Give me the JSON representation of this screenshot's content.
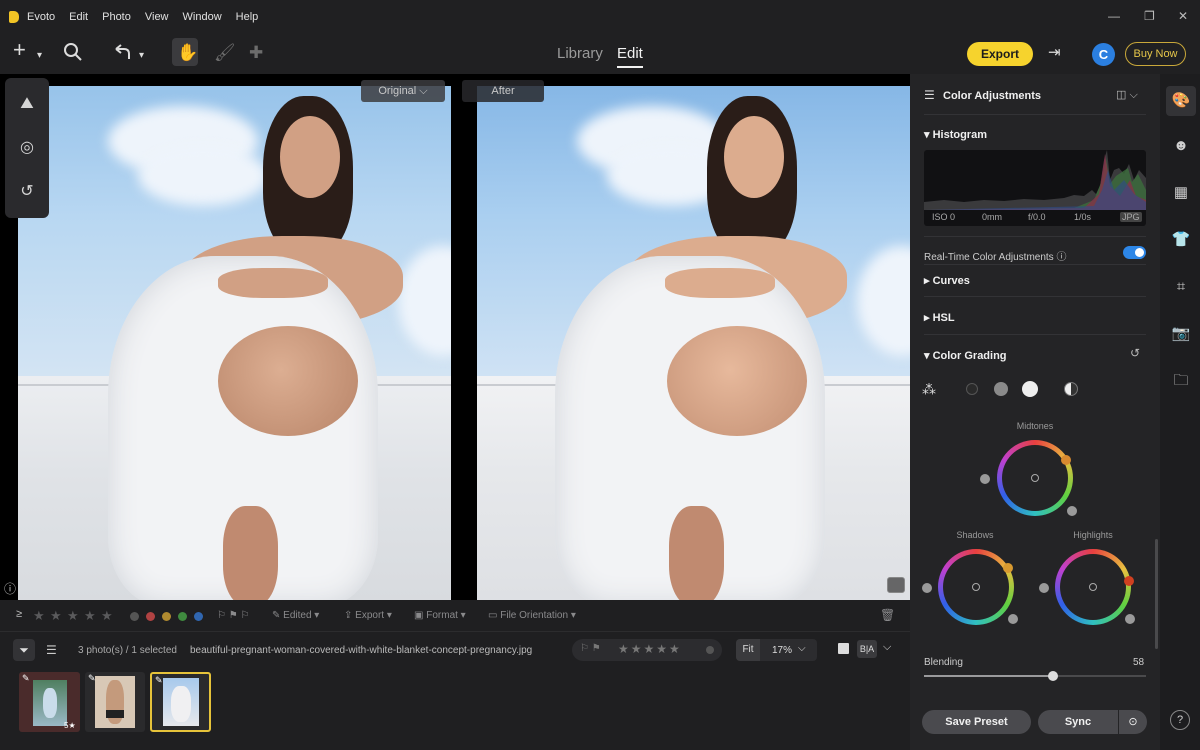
{
  "menu": {
    "items": [
      "Evoto",
      "Edit",
      "Photo",
      "View",
      "Window",
      "Help"
    ]
  },
  "window_controls": {
    "minimize": "—",
    "maximize": "❐",
    "close": "✕"
  },
  "toolbar": {
    "modes": [
      "Library",
      "Edit"
    ],
    "export_label": "Export",
    "avatar_letter": "C",
    "buy_label": "Buy Now"
  },
  "canvas": {
    "original_label": "Original",
    "after_label": "After"
  },
  "filmstrip": {
    "filters": [
      "Edited",
      "Export",
      "Format",
      "File Orientation"
    ],
    "count_text": "3 photo(s) / 1 selected",
    "filename": "beautiful-pregnant-woman-covered-with-white-blanket-concept-pregnancy.jpg",
    "fit_label": "Fit",
    "zoom": "17%",
    "ba_label": "B|A",
    "thumb_badge": "5★",
    "label_colors": [
      "#e05050",
      "#e0a030",
      "#50b050",
      "#3080e0"
    ]
  },
  "panel": {
    "title": "Color Adjustments",
    "histogram_label": "Histogram",
    "exif": [
      "ISO 0",
      "0mm",
      "f/0.0",
      "1/0s",
      "JPG"
    ],
    "realtime_label": "Real-Time Color Adjustments",
    "realtime_on": true,
    "curves_label": "Curves",
    "hsl_label": "HSL",
    "grading_label": "Color Grading",
    "midtones_label": "Midtones",
    "shadows_label": "Shadows",
    "highlights_label": "Highlights",
    "blending_label": "Blending",
    "blending_value": "58",
    "blending_fraction": 0.58,
    "save_preset_label": "Save Preset",
    "sync_label": "Sync"
  }
}
